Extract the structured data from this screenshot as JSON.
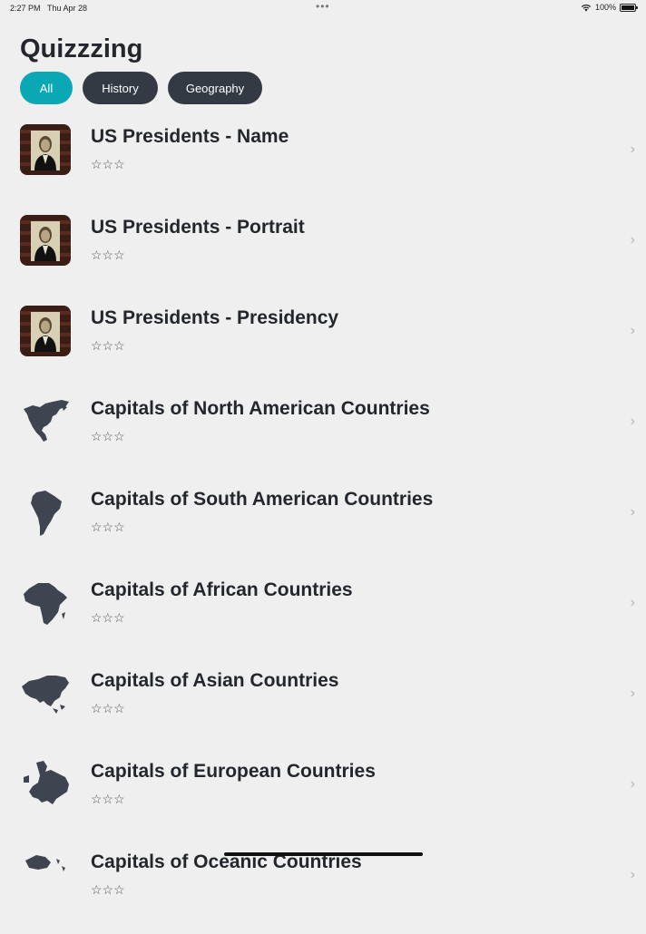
{
  "status_bar": {
    "time": "2:27 PM",
    "date": "Thu Apr 28",
    "dots": "•••",
    "battery_percent": "100%",
    "battery_level": 1.0,
    "wifi_icon": "wifi-icon",
    "battery_icon": "battery-icon"
  },
  "page": {
    "title": "Quizzzing"
  },
  "filters": [
    {
      "label": "All",
      "active": true
    },
    {
      "label": "History",
      "active": false
    },
    {
      "label": "Geography",
      "active": false
    }
  ],
  "quizzes": [
    {
      "title": "US Presidents - Name",
      "icon": "lincoln-portrait-icon",
      "stars": "☆☆☆",
      "rating": 0
    },
    {
      "title": "US Presidents - Portrait",
      "icon": "lincoln-portrait-icon",
      "stars": "☆☆☆",
      "rating": 0
    },
    {
      "title": "US Presidents - Presidency",
      "icon": "lincoln-portrait-icon",
      "stars": "☆☆☆",
      "rating": 0
    },
    {
      "title": "Capitals of North American Countries",
      "icon": "north-america-map-icon",
      "stars": "☆☆☆",
      "rating": 0
    },
    {
      "title": "Capitals of South American Countries",
      "icon": "south-america-map-icon",
      "stars": "☆☆☆",
      "rating": 0
    },
    {
      "title": "Capitals of African Countries",
      "icon": "africa-map-icon",
      "stars": "☆☆☆",
      "rating": 0
    },
    {
      "title": "Capitals of Asian Countries",
      "icon": "asia-map-icon",
      "stars": "☆☆☆",
      "rating": 0
    },
    {
      "title": "Capitals of European Countries",
      "icon": "europe-map-icon",
      "stars": "☆☆☆",
      "rating": 0
    },
    {
      "title": "Capitals of Oceanic Countries",
      "icon": "oceania-map-icon",
      "stars": "☆☆☆",
      "rating": 0
    }
  ],
  "chevron_glyph": "›",
  "colors": {
    "accent": "#0aa8b5",
    "chip_dark": "#343a43",
    "background": "#efefef"
  }
}
